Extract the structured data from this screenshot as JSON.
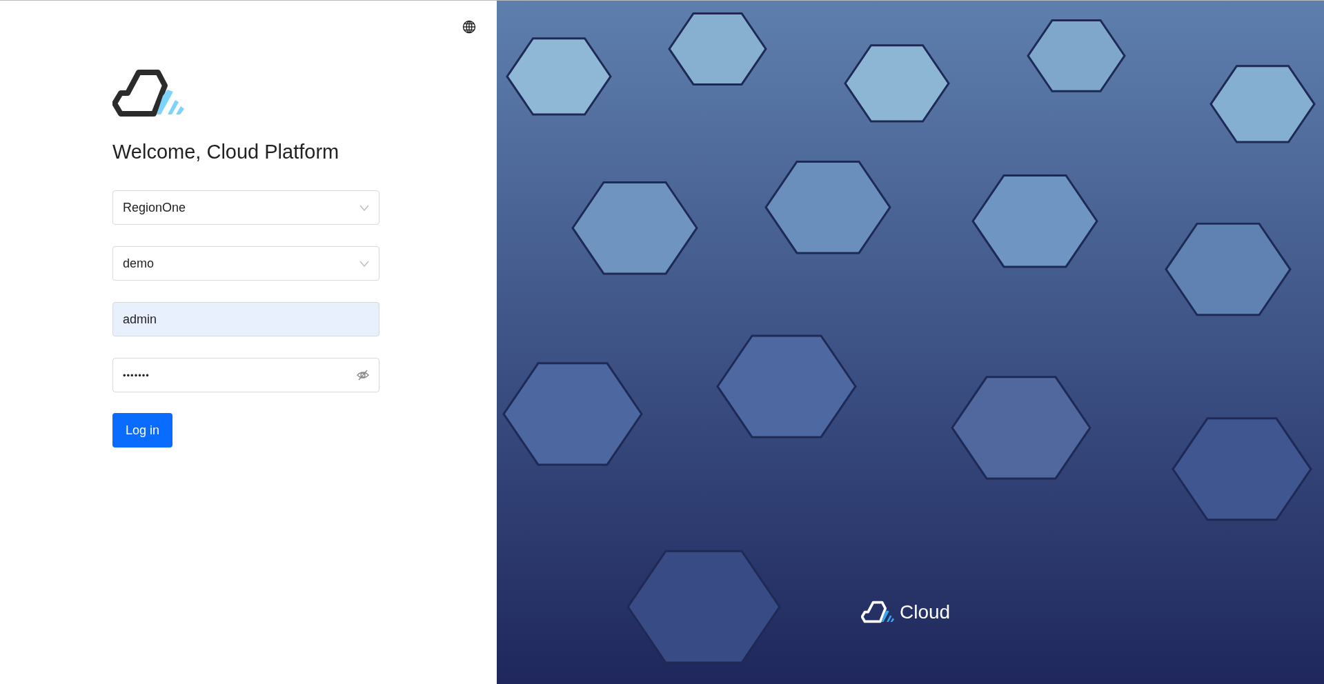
{
  "heading": "Welcome, Cloud Platform",
  "fields": [
    {
      "kind": "select",
      "value": "RegionOne",
      "autofilled": false
    },
    {
      "kind": "select",
      "value": "demo",
      "autofilled": false
    },
    {
      "kind": "text",
      "value": "admin",
      "autofilled": true
    },
    {
      "kind": "password",
      "value": "•••••••",
      "autofilled": false
    }
  ],
  "submit": "Log in",
  "hero": {
    "kind": "picture",
    "brand": "Cloud"
  }
}
